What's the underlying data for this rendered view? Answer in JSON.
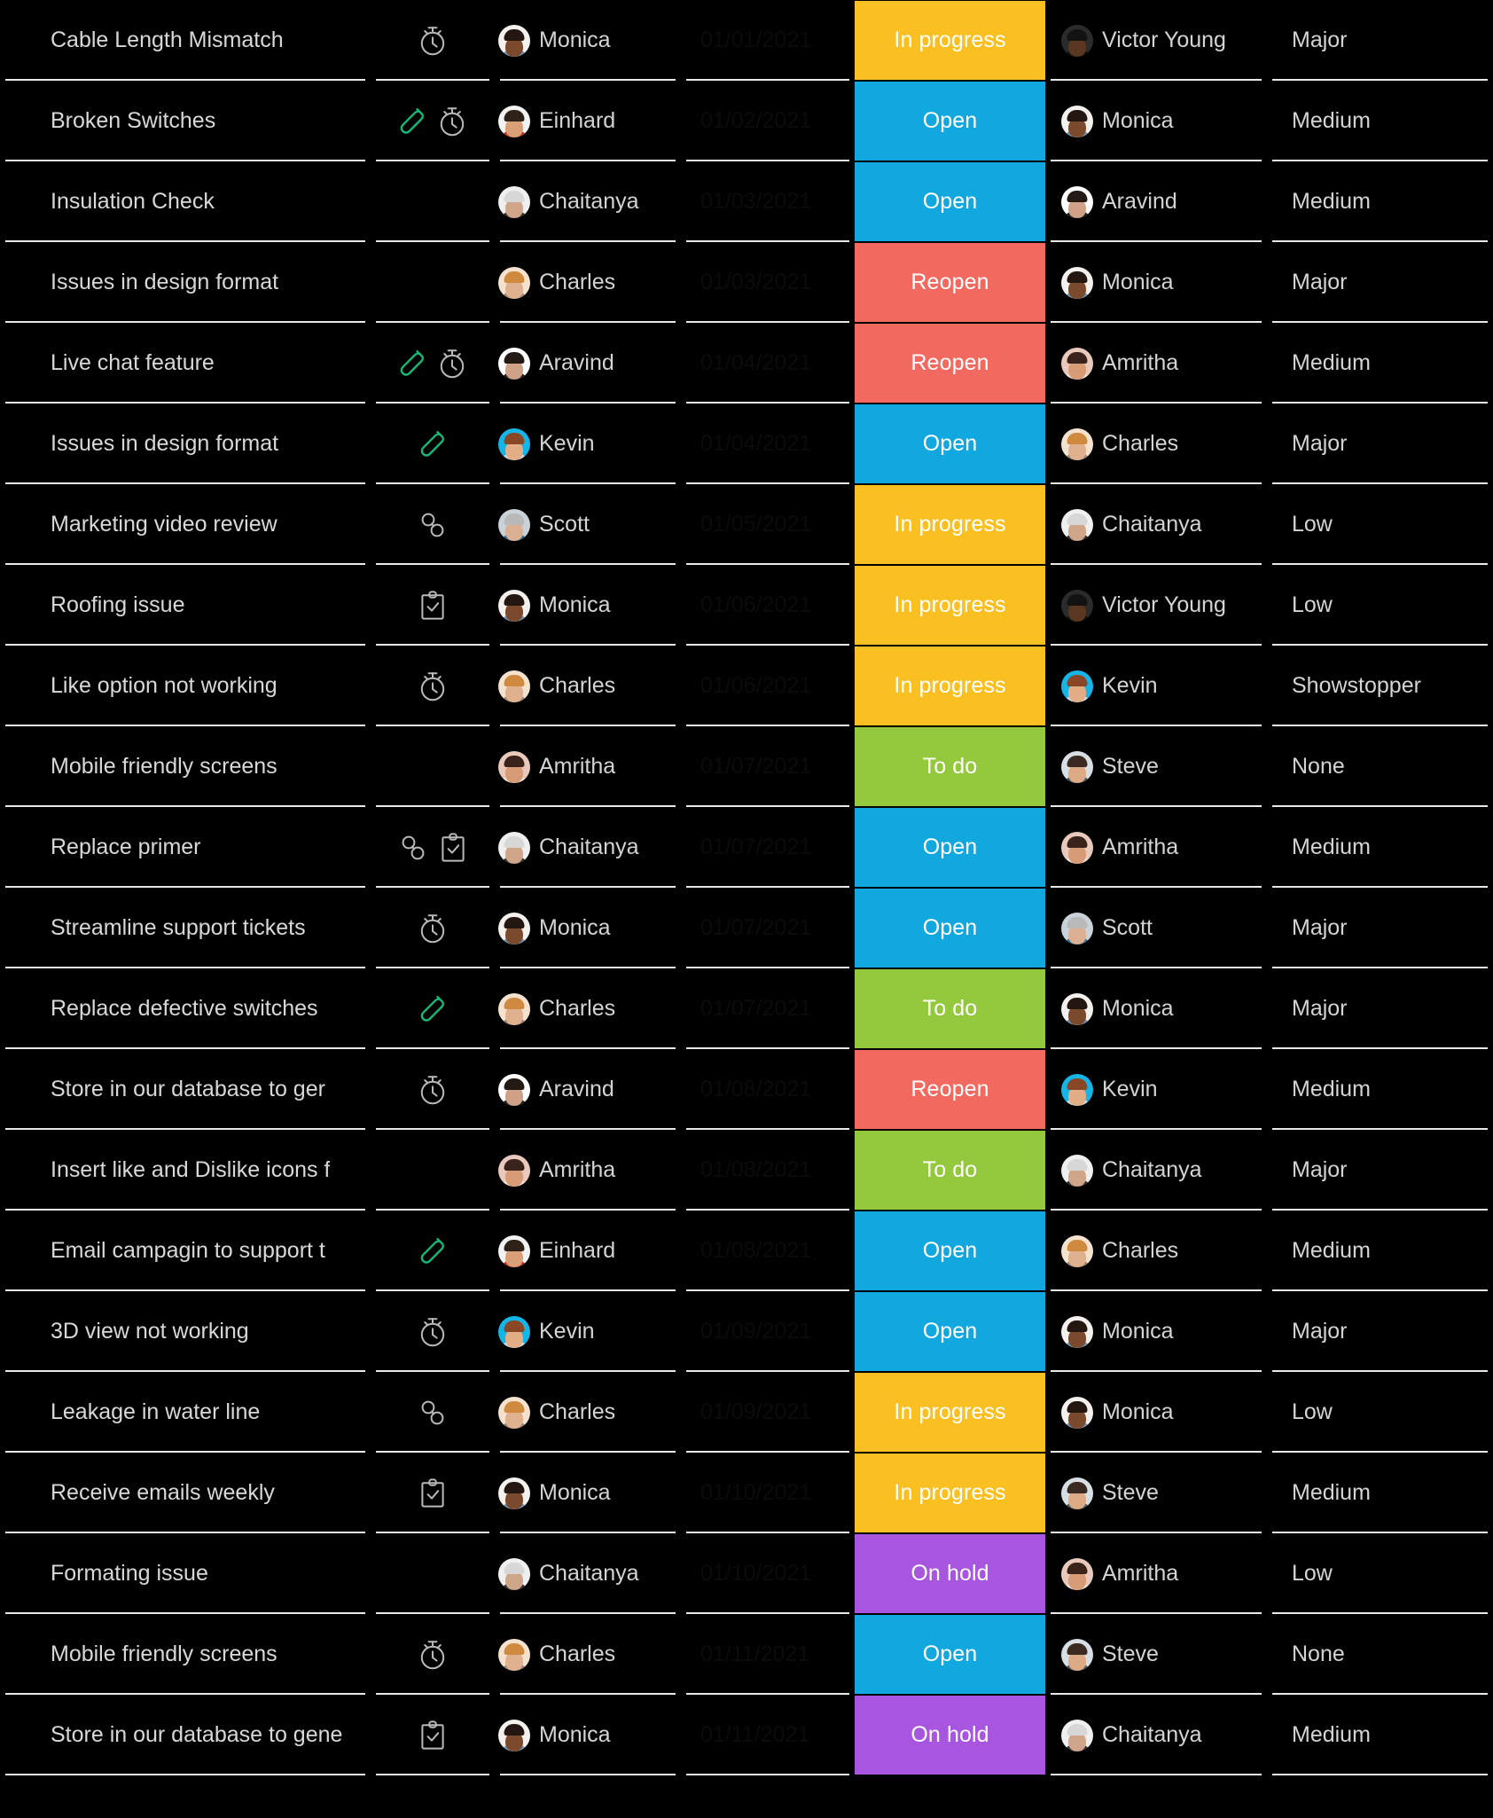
{
  "theme": {
    "background": "#000000",
    "divider": "#e9e9e9",
    "text": "#d4d4d4",
    "date_text": "#0b0b0b",
    "escalate_icon": "#17b978"
  },
  "status_colors": {
    "In progress": "#fac021",
    "Open": "#11a8e0",
    "Reopen": "#f2695f",
    "To do": "#95c93d",
    "On hold": "#a855e0"
  },
  "avatar_palette": {
    "Monica": {
      "bg": "#f4f0ed",
      "skin": "#7b4a2d",
      "hair": "#241712",
      "body": "#6f94b4"
    },
    "Einhard": {
      "bg": "#f2f2f2",
      "skin": "#d9a077",
      "hair": "#2e2118",
      "body": "#c52b25"
    },
    "Chaitanya": {
      "bg": "#efefef",
      "skin": "#cfa68a",
      "hair": "#d7d7d7",
      "body": "#2b2b2b"
    },
    "Charles": {
      "bg": "#f4e2cf",
      "skin": "#e0b18f",
      "hair": "#d08a3f",
      "body": "#9b8878"
    },
    "Aravind": {
      "bg": "#ffffff",
      "skin": "#cfa287",
      "hair": "#241a14",
      "body": "#1b1b1b"
    },
    "Kevin": {
      "bg": "#15b5e8",
      "skin": "#e3ae85",
      "hair": "#8a4726",
      "body": "#cfdbe4"
    },
    "Scott": {
      "bg": "#c9d2d8",
      "skin": "#dbb093",
      "hair": "#b9b9b9",
      "body": "#2d6f93"
    },
    "Amritha": {
      "bg": "#e9c9bb",
      "skin": "#d79b76",
      "hair": "#3a231a",
      "body": "#efe6e0"
    },
    "Steve": {
      "bg": "#d7dfe4",
      "skin": "#dcab86",
      "hair": "#3b2a1f",
      "body": "#4a5a66"
    },
    "Victor Young": {
      "bg": "#2b2b2b",
      "skin": "#5a3720",
      "hair": "#131313",
      "body": "#101010"
    }
  },
  "icons": {
    "escalate": "escalate-icon",
    "timer": "timer-icon",
    "linked": "linked-issues-icon",
    "checklist": "checklist-icon"
  },
  "rows": [
    {
      "title": "Cable Length Mismatch",
      "icons": [
        "timer"
      ],
      "owner": "Monica",
      "date": "01/01/2021",
      "status": "In progress",
      "assignee": "Victor Young",
      "priority": "Major"
    },
    {
      "title": "Broken Switches",
      "icons": [
        "escalate",
        "timer"
      ],
      "owner": "Einhard",
      "date": "01/02/2021",
      "status": "Open",
      "assignee": "Monica",
      "priority": "Medium"
    },
    {
      "title": "Insulation Check",
      "icons": [],
      "owner": "Chaitanya",
      "date": "01/03/2021",
      "status": "Open",
      "assignee": "Aravind",
      "priority": "Medium"
    },
    {
      "title": "Issues in design format",
      "icons": [],
      "owner": "Charles",
      "date": "01/03/2021",
      "status": "Reopen",
      "assignee": "Monica",
      "priority": "Major"
    },
    {
      "title": "Live chat feature",
      "icons": [
        "escalate",
        "timer"
      ],
      "owner": "Aravind",
      "date": "01/04/2021",
      "status": "Reopen",
      "assignee": "Amritha",
      "priority": "Medium"
    },
    {
      "title": "Issues in design format",
      "icons": [
        "escalate"
      ],
      "owner": "Kevin",
      "date": "01/04/2021",
      "status": "Open",
      "assignee": "Charles",
      "priority": "Major"
    },
    {
      "title": "Marketing video review",
      "icons": [
        "linked"
      ],
      "owner": "Scott",
      "date": "01/05/2021",
      "status": "In progress",
      "assignee": "Chaitanya",
      "priority": "Low"
    },
    {
      "title": "Roofing issue",
      "icons": [
        "checklist"
      ],
      "owner": "Monica",
      "date": "01/06/2021",
      "status": "In progress",
      "assignee": "Victor Young",
      "priority": "Low"
    },
    {
      "title": "Like option not working",
      "icons": [
        "timer"
      ],
      "owner": "Charles",
      "date": "01/06/2021",
      "status": "In progress",
      "assignee": "Kevin",
      "priority": "Showstopper"
    },
    {
      "title": "Mobile friendly screens",
      "icons": [],
      "owner": "Amritha",
      "date": "01/07/2021",
      "status": "To do",
      "assignee": "Steve",
      "priority": "None"
    },
    {
      "title": "Replace primer",
      "icons": [
        "linked",
        "checklist"
      ],
      "owner": "Chaitanya",
      "date": "01/07/2021",
      "status": "Open",
      "assignee": "Amritha",
      "priority": "Medium"
    },
    {
      "title": "Streamline support tickets",
      "icons": [
        "timer"
      ],
      "owner": "Monica",
      "date": "01/07/2021",
      "status": "Open",
      "assignee": "Scott",
      "priority": "Major"
    },
    {
      "title": "Replace defective switches",
      "icons": [
        "escalate"
      ],
      "owner": "Charles",
      "date": "01/07/2021",
      "status": "To do",
      "assignee": "Monica",
      "priority": "Major"
    },
    {
      "title": "Store in our database to ger",
      "icons": [
        "timer"
      ],
      "owner": "Aravind",
      "date": "01/08/2021",
      "status": "Reopen",
      "assignee": "Kevin",
      "priority": "Medium"
    },
    {
      "title": "Insert like and Dislike icons f",
      "icons": [],
      "owner": "Amritha",
      "date": "01/08/2021",
      "status": "To do",
      "assignee": "Chaitanya",
      "priority": "Major"
    },
    {
      "title": "Email campagin to support t",
      "icons": [
        "escalate"
      ],
      "owner": "Einhard",
      "date": "01/08/2021",
      "status": "Open",
      "assignee": "Charles",
      "priority": "Medium"
    },
    {
      "title": "3D view not working",
      "icons": [
        "timer"
      ],
      "owner": "Kevin",
      "date": "01/09/2021",
      "status": "Open",
      "assignee": "Monica",
      "priority": "Major"
    },
    {
      "title": "Leakage in water line",
      "icons": [
        "linked"
      ],
      "owner": "Charles",
      "date": "01/09/2021",
      "status": "In progress",
      "assignee": "Monica",
      "priority": "Low"
    },
    {
      "title": "Receive emails weekly",
      "icons": [
        "checklist"
      ],
      "owner": "Monica",
      "date": "01/10/2021",
      "status": "In progress",
      "assignee": "Steve",
      "priority": "Medium"
    },
    {
      "title": "Formating issue",
      "icons": [],
      "owner": "Chaitanya",
      "date": "01/10/2021",
      "status": "On hold",
      "assignee": "Amritha",
      "priority": "Low"
    },
    {
      "title": "Mobile friendly screens",
      "icons": [
        "timer"
      ],
      "owner": "Charles",
      "date": "01/11/2021",
      "status": "Open",
      "assignee": "Steve",
      "priority": "None"
    },
    {
      "title": "Store in our database to gene",
      "icons": [
        "checklist"
      ],
      "owner": "Monica",
      "date": "01/11/2021",
      "status": "On hold",
      "assignee": "Chaitanya",
      "priority": "Medium"
    }
  ]
}
